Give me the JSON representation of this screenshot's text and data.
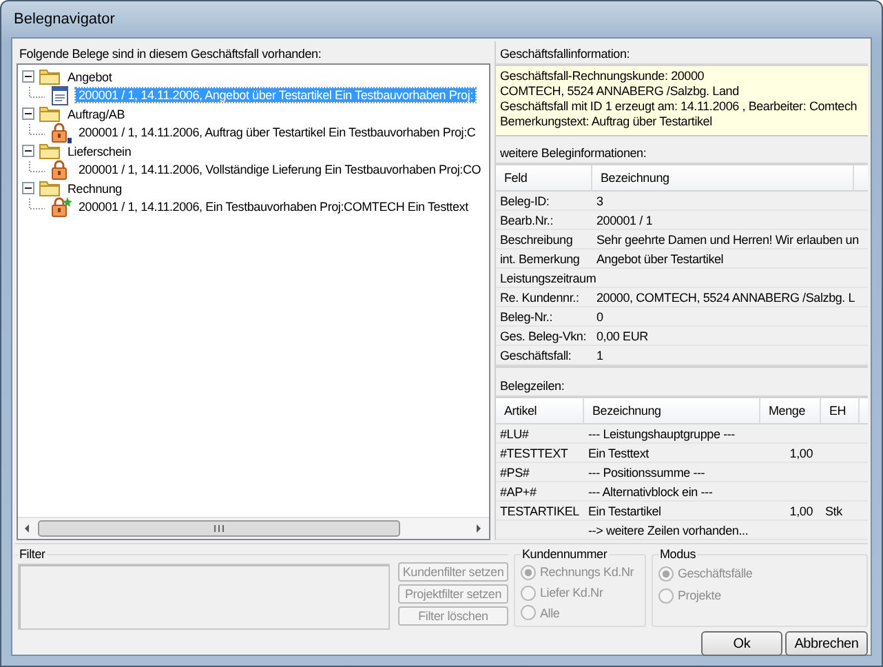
{
  "window": {
    "title": "Belegnavigator"
  },
  "tree": {
    "label": "Folgende Belege sind in diesem Geschäftsfall vorhanden:",
    "nodes": [
      {
        "label": "Angebot",
        "expanded": true,
        "selected": false,
        "children": [
          {
            "label": "200001 / 1, 14.11.2006, Angebot über Testartikel Ein Testbauvorhaben  Proj:",
            "kind": "document",
            "selected": true
          }
        ]
      },
      {
        "label": "Auftrag/AB",
        "expanded": true,
        "selected": false,
        "children": [
          {
            "label": "200001 / 1, 14.11.2006, Auftrag über Testartikel Ein Testbauvorhaben  Proj:C",
            "kind": "held",
            "selected": false
          }
        ]
      },
      {
        "label": "Lieferschein",
        "expanded": true,
        "selected": false,
        "children": [
          {
            "label": "200001 / 1, 14.11.2006, Vollständige Lieferung Ein Testbauvorhaben  Proj:CO",
            "kind": "locked",
            "selected": false
          }
        ]
      },
      {
        "label": "Rechnung",
        "expanded": true,
        "selected": false,
        "children": [
          {
            "label": "200001 / 1, 14.11.2006, Ein Testbauvorhaben  Proj:COMTECH Ein Testtext",
            "kind": "booked",
            "selected": false
          }
        ]
      }
    ]
  },
  "case_info": {
    "label": "Geschäftsfallinformation:",
    "lines": [
      "Geschäftsfall-Rechnungskunde: 20000",
      "COMTECH, 5524 ANNABERG /Salzbg. Land",
      "Geschäftsfall mit ID 1 erzeugt am: 14.11.2006 , Bearbeiter: Comtech",
      "Bemerkungstext: Auftrag über Testartikel"
    ]
  },
  "document_info": {
    "label": "weitere Beleginformationen:",
    "columns": [
      "Feld",
      "Bezeichnung"
    ],
    "rows": [
      {
        "field": "Beleg-ID:",
        "value": "3"
      },
      {
        "field": "Bearb.Nr.:",
        "value": "200001 / 1"
      },
      {
        "field": "Beschreibung",
        "value": "Sehr geehrte Damen und Herren!  Wir erlauben un"
      },
      {
        "field": "int. Bemerkung",
        "value": "Angebot über Testartikel"
      },
      {
        "field": "Leistungszeitraum"
      },
      {
        "field": "Re. Kundennr.:",
        "value": "20000, COMTECH, 5524 ANNABERG /Salzbg. L"
      },
      {
        "field": "Beleg-Nr.:",
        "value": "0"
      },
      {
        "field": "Ges. Beleg-Vkn:",
        "value": "0,00  EUR"
      },
      {
        "field": "Geschäftsfall:",
        "value": "1"
      }
    ]
  },
  "document_lines": {
    "label": "Belegzeilen:",
    "columns": [
      "Artikel",
      "Bezeichnung",
      "Menge",
      "EH"
    ],
    "rows": [
      {
        "article": "#LU#",
        "description": "--- Leistungshauptgruppe ---"
      },
      {
        "article": "#TESTTEXT",
        "description": "Ein Testtext",
        "quantity": "1,00"
      },
      {
        "article": "#PS#",
        "description": "--- Positionssumme ---"
      },
      {
        "article": "#AP+#",
        "description": "--- Alternativblock ein ---"
      },
      {
        "article": "TESTARTIKEL",
        "description": "Ein Testartikel",
        "quantity": "1,00",
        "unit": "Stk"
      },
      {
        "description": "--> weitere Zeilen vorhanden..."
      }
    ]
  },
  "filter": {
    "label": "Filter",
    "buttons": [
      {
        "label": "Kundenfilter setzen",
        "disabled": true
      },
      {
        "label": "Projektfilter setzen",
        "disabled": true
      },
      {
        "label": "Filter löschen",
        "disabled": true
      }
    ]
  },
  "customer_number": {
    "label": "Kundennummer",
    "options": [
      {
        "label": "Rechnungs Kd.Nr",
        "selected": true,
        "disabled": true
      },
      {
        "label": "Liefer Kd.Nr",
        "selected": false,
        "disabled": true
      },
      {
        "label": "Alle",
        "selected": false,
        "disabled": true
      }
    ]
  },
  "mode": {
    "label": "Modus",
    "options": [
      {
        "label": "Geschäftsfälle",
        "selected": true,
        "disabled": true
      },
      {
        "label": "Projekte",
        "selected": false,
        "disabled": true
      }
    ]
  },
  "buttons": [
    {
      "label": "Ok"
    },
    {
      "label": "Abbrechen"
    }
  ]
}
